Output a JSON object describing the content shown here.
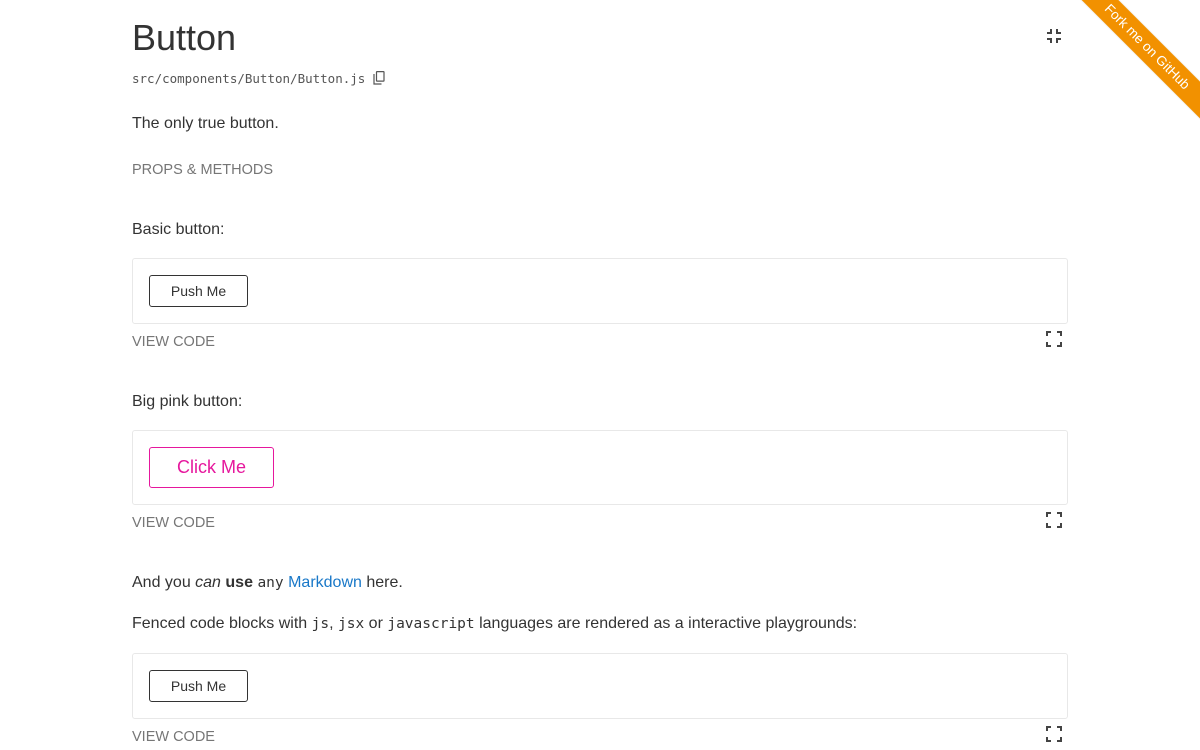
{
  "header": {
    "title": "Button",
    "path": "src/components/Button/Button.js",
    "description": "The only true button.",
    "props_link": "PROPS & METHODS"
  },
  "ribbon": {
    "label": "Fork me on GitHub",
    "color": "#f29100"
  },
  "sections": [
    {
      "heading": "Basic button:",
      "button_label": "Push Me",
      "view_code": "VIEW CODE"
    },
    {
      "heading": "Big pink button:",
      "button_label": "Click Me",
      "button_color": "#e6179d",
      "view_code": "VIEW CODE"
    },
    {
      "button_label": "Push Me",
      "view_code": "VIEW CODE"
    }
  ],
  "markdown_line": {
    "part1": "And you ",
    "italic": "can",
    "bold": "use",
    "code": "any",
    "link": "Markdown",
    "part_end": " here."
  },
  "fenced_line": {
    "part1": "Fenced code blocks with ",
    "code1": "js",
    "sep1": ", ",
    "code2": "jsx",
    "sep2": " or ",
    "code3": "javascript",
    "part_end": " languages are rendered as a interactive playgrounds:"
  },
  "icons": {
    "copy": "copy-icon",
    "fullscreen": "fullscreen-icon",
    "collapse": "collapse-icon"
  },
  "colors": {
    "link": "#1978c8",
    "muted": "#767676",
    "pink": "#e6179d"
  }
}
